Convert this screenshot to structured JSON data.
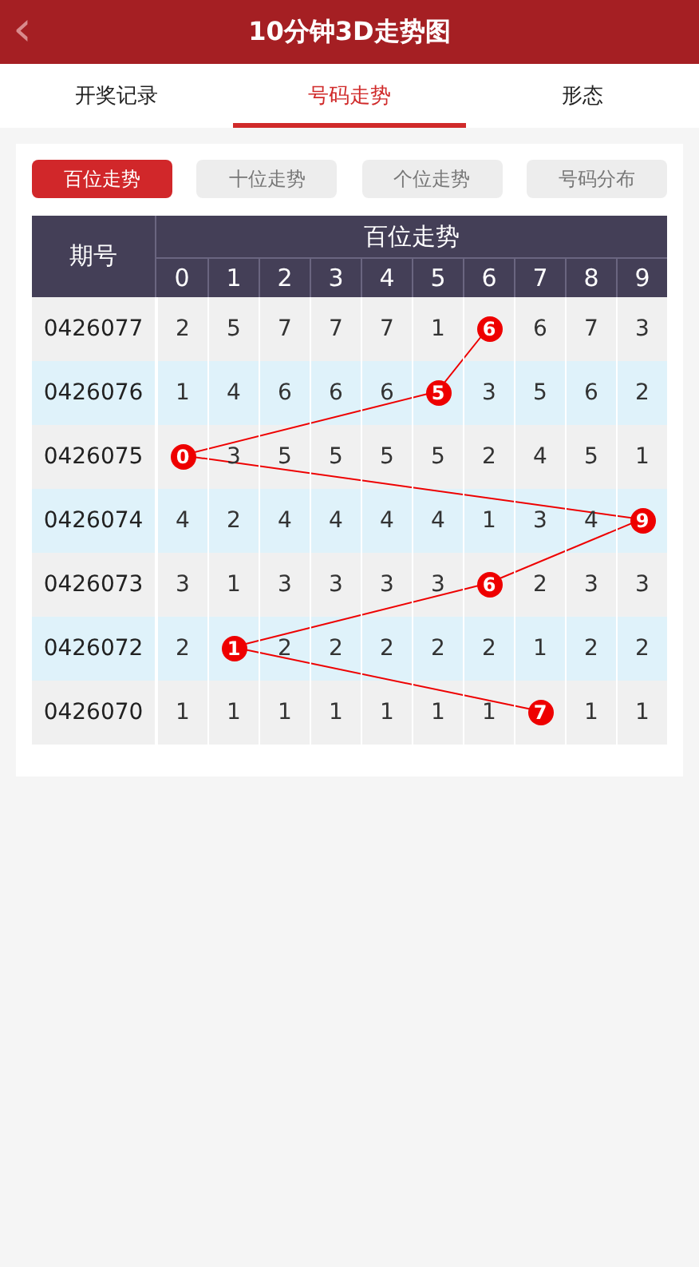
{
  "header": {
    "back": "‹",
    "title": "10分钟3D走势图"
  },
  "tabs": [
    {
      "label": "开奖记录",
      "selected": false
    },
    {
      "label": "号码走势",
      "selected": true
    },
    {
      "label": "形态",
      "selected": false
    }
  ],
  "subtabs": [
    {
      "label": "百位走势",
      "selected": true
    },
    {
      "label": "十位走势",
      "selected": false
    },
    {
      "label": "个位走势",
      "selected": false
    },
    {
      "label": "号码分布",
      "selected": false
    }
  ],
  "table": {
    "period_heading": "期号",
    "group_heading": "百位走势",
    "digits": [
      "0",
      "1",
      "2",
      "3",
      "4",
      "5",
      "6",
      "7",
      "8",
      "9"
    ],
    "rows": [
      {
        "period": "0426077",
        "cells": [
          {
            "text": "2",
            "hit": false
          },
          {
            "text": "5",
            "hit": false
          },
          {
            "text": "7",
            "hit": false
          },
          {
            "text": "7",
            "hit": false
          },
          {
            "text": "7",
            "hit": false
          },
          {
            "text": "1",
            "hit": false
          },
          {
            "text": "6",
            "hit": true
          },
          {
            "text": "6",
            "hit": false
          },
          {
            "text": "7",
            "hit": false
          },
          {
            "text": "3",
            "hit": false
          }
        ]
      },
      {
        "period": "0426076",
        "cells": [
          {
            "text": "1",
            "hit": false
          },
          {
            "text": "4",
            "hit": false
          },
          {
            "text": "6",
            "hit": false
          },
          {
            "text": "6",
            "hit": false
          },
          {
            "text": "6",
            "hit": false
          },
          {
            "text": "5",
            "hit": true
          },
          {
            "text": "3",
            "hit": false
          },
          {
            "text": "5",
            "hit": false
          },
          {
            "text": "6",
            "hit": false
          },
          {
            "text": "2",
            "hit": false
          }
        ]
      },
      {
        "period": "0426075",
        "cells": [
          {
            "text": "0",
            "hit": true
          },
          {
            "text": "3",
            "hit": false
          },
          {
            "text": "5",
            "hit": false
          },
          {
            "text": "5",
            "hit": false
          },
          {
            "text": "5",
            "hit": false
          },
          {
            "text": "5",
            "hit": false
          },
          {
            "text": "2",
            "hit": false
          },
          {
            "text": "4",
            "hit": false
          },
          {
            "text": "5",
            "hit": false
          },
          {
            "text": "1",
            "hit": false
          }
        ]
      },
      {
        "period": "0426074",
        "cells": [
          {
            "text": "4",
            "hit": false
          },
          {
            "text": "2",
            "hit": false
          },
          {
            "text": "4",
            "hit": false
          },
          {
            "text": "4",
            "hit": false
          },
          {
            "text": "4",
            "hit": false
          },
          {
            "text": "4",
            "hit": false
          },
          {
            "text": "1",
            "hit": false
          },
          {
            "text": "3",
            "hit": false
          },
          {
            "text": "4",
            "hit": false
          },
          {
            "text": "9",
            "hit": true
          }
        ]
      },
      {
        "period": "0426073",
        "cells": [
          {
            "text": "3",
            "hit": false
          },
          {
            "text": "1",
            "hit": false
          },
          {
            "text": "3",
            "hit": false
          },
          {
            "text": "3",
            "hit": false
          },
          {
            "text": "3",
            "hit": false
          },
          {
            "text": "3",
            "hit": false
          },
          {
            "text": "6",
            "hit": true
          },
          {
            "text": "2",
            "hit": false
          },
          {
            "text": "3",
            "hit": false
          },
          {
            "text": "3",
            "hit": false
          }
        ]
      },
      {
        "period": "0426072",
        "cells": [
          {
            "text": "2",
            "hit": false
          },
          {
            "text": "1",
            "hit": true
          },
          {
            "text": "2",
            "hit": false
          },
          {
            "text": "2",
            "hit": false
          },
          {
            "text": "2",
            "hit": false
          },
          {
            "text": "2",
            "hit": false
          },
          {
            "text": "2",
            "hit": false
          },
          {
            "text": "1",
            "hit": false
          },
          {
            "text": "2",
            "hit": false
          },
          {
            "text": "2",
            "hit": false
          }
        ]
      },
      {
        "period": "0426070",
        "cells": [
          {
            "text": "1",
            "hit": false
          },
          {
            "text": "1",
            "hit": false
          },
          {
            "text": "1",
            "hit": false
          },
          {
            "text": "1",
            "hit": false
          },
          {
            "text": "1",
            "hit": false
          },
          {
            "text": "1",
            "hit": false
          },
          {
            "text": "1",
            "hit": false
          },
          {
            "text": "7",
            "hit": true
          },
          {
            "text": "1",
            "hit": false
          },
          {
            "text": "1",
            "hit": false
          }
        ]
      }
    ]
  }
}
